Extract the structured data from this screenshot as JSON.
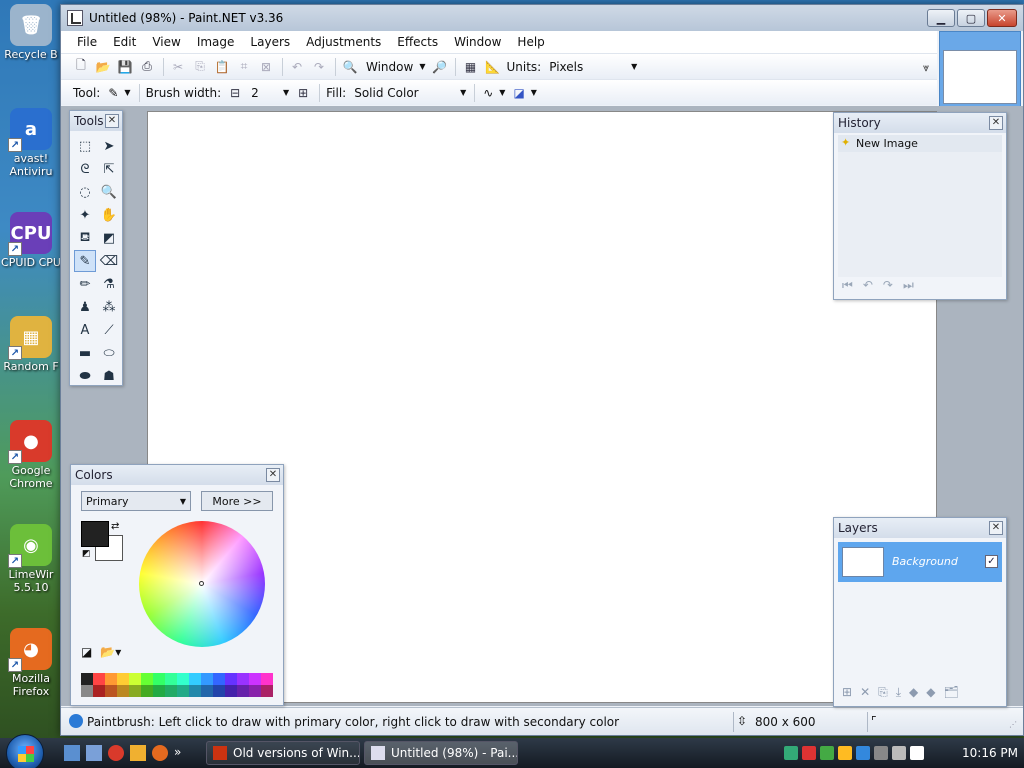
{
  "desktop": {
    "icons": [
      {
        "label": "Recycle B",
        "glyph": "🗑",
        "color": "#9bb4cc"
      },
      {
        "label": "avast! Antiviru",
        "glyph": "a",
        "color": "#2a6fcf"
      },
      {
        "label": "CPUID CPU",
        "glyph": "CPU",
        "color": "#6a3fb8"
      },
      {
        "label": "Random F",
        "glyph": "▦",
        "color": "#e0b340"
      },
      {
        "label": "Google Chrome",
        "glyph": "●",
        "color": "#d93a2b"
      },
      {
        "label": "LimeWir 5.5.10",
        "glyph": "◉",
        "color": "#6cbf3a"
      },
      {
        "label": "Mozilla Firefox",
        "glyph": "◕",
        "color": "#e56a1f"
      }
    ]
  },
  "window": {
    "title": "Untitled (98%) - Paint.NET v3.36",
    "menu": [
      "File",
      "Edit",
      "View",
      "Image",
      "Layers",
      "Adjustments",
      "Effects",
      "Window",
      "Help"
    ],
    "zoom_value": "Window",
    "units_label": "Units:",
    "units_value": "Pixels",
    "tool_label": "Tool:",
    "brush_width_label": "Brush width:",
    "brush_width_value": "2",
    "fill_label": "Fill:",
    "fill_value": "Solid Color"
  },
  "tools_panel": {
    "title": "Tools",
    "tools": [
      {
        "name": "rectangle-select-icon",
        "glyph": "⬚",
        "active": false
      },
      {
        "name": "move-selection-icon",
        "glyph": "➤",
        "active": false
      },
      {
        "name": "lasso-select-icon",
        "glyph": "ᘓ",
        "active": false
      },
      {
        "name": "move-selected-icon",
        "glyph": "⇱",
        "active": false
      },
      {
        "name": "ellipse-select-icon",
        "glyph": "◌",
        "active": false
      },
      {
        "name": "zoom-icon",
        "glyph": "🔍",
        "active": false
      },
      {
        "name": "magic-wand-icon",
        "glyph": "✦",
        "active": false
      },
      {
        "name": "pan-hand-icon",
        "glyph": "✋",
        "active": false
      },
      {
        "name": "paint-bucket-icon",
        "glyph": "⛾",
        "active": false
      },
      {
        "name": "gradient-icon",
        "glyph": "◩",
        "active": false
      },
      {
        "name": "paintbrush-icon",
        "glyph": "✎",
        "active": true
      },
      {
        "name": "eraser-icon",
        "glyph": "⌫",
        "active": false
      },
      {
        "name": "pencil-icon",
        "glyph": "✏",
        "active": false
      },
      {
        "name": "color-picker-icon",
        "glyph": "⚗",
        "active": false
      },
      {
        "name": "clone-stamp-icon",
        "glyph": "♟",
        "active": false
      },
      {
        "name": "recolor-icon",
        "glyph": "⁂",
        "active": false
      },
      {
        "name": "text-icon",
        "glyph": "A",
        "active": false
      },
      {
        "name": "line-curve-icon",
        "glyph": "⟋",
        "active": false
      },
      {
        "name": "rectangle-icon",
        "glyph": "▬",
        "active": false
      },
      {
        "name": "rounded-rectangle-icon",
        "glyph": "⬭",
        "active": false
      },
      {
        "name": "ellipse-icon",
        "glyph": "⬬",
        "active": false
      },
      {
        "name": "freeform-shape-icon",
        "glyph": "☗",
        "active": false
      }
    ]
  },
  "history_panel": {
    "title": "History",
    "items": [
      "New Image"
    ]
  },
  "colors_panel": {
    "title": "Colors",
    "mode_value": "Primary",
    "more_label": "More >>",
    "primary_color": "#222222",
    "secondary_color": "#ffffff",
    "palette": [
      "#222",
      "#f44",
      "#f93",
      "#fc3",
      "#cf3",
      "#6f3",
      "#3f6",
      "#3f9",
      "#3fc",
      "#3cf",
      "#39f",
      "#36f",
      "#63f",
      "#93f",
      "#c3f",
      "#f3c",
      "#888",
      "#a22",
      "#b52",
      "#b82",
      "#8a2",
      "#4a2",
      "#2a4",
      "#2a6",
      "#2a8",
      "#28a",
      "#26a",
      "#24a",
      "#42a",
      "#62a",
      "#82a",
      "#a26"
    ]
  },
  "layers_panel": {
    "title": "Layers",
    "layers": [
      {
        "name": "Background",
        "visible": true
      }
    ]
  },
  "status": {
    "hint": "Paintbrush: Left click to draw with primary color, right click to draw with secondary color",
    "image_size": "800 x 600"
  },
  "taskbar": {
    "tasks": [
      {
        "label": "Old versions of Win...",
        "active": false,
        "icon_color": "#c31"
      },
      {
        "label": "Untitled (98%) - Pai...",
        "active": true,
        "icon_color": "#dde"
      }
    ],
    "clock": "10:16 PM",
    "tray_colors": [
      "#3a7",
      "#d33",
      "#4a4",
      "#fb2",
      "#38d",
      "#888",
      "#bbb",
      "#fff"
    ]
  }
}
